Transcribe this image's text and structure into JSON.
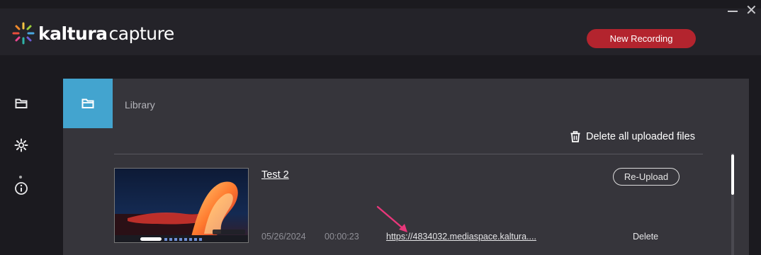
{
  "app": {
    "brand": "kaltura",
    "product": "capture",
    "new_recording_label": "New Recording",
    "accent": "#43a4cf",
    "record_color": "#b3242e"
  },
  "window_controls": {
    "minimize_icon": "minimize-icon",
    "close_icon": "close-icon",
    "close_glyph": "✕"
  },
  "sidebar": {
    "items": [
      {
        "icon": "folder-icon",
        "active": true
      },
      {
        "icon": "gear-icon"
      },
      {
        "icon": "info-icon"
      }
    ]
  },
  "library": {
    "tab_icon": "folder-icon",
    "title": "Library",
    "delete_all_label": "Delete all uploaded files",
    "recordings": [
      {
        "title": "Test 2",
        "reupload_label": "Re-Upload",
        "date": "05/26/2024",
        "duration": "00:00:23",
        "url": "https://4834032.mediaspace.kaltura....",
        "delete_label": "Delete"
      }
    ]
  }
}
